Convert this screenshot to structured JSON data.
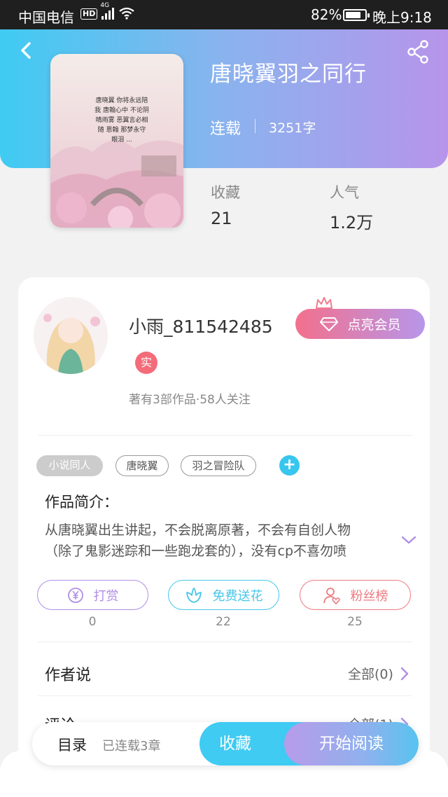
{
  "status_bar": {
    "carrier": "中国电信",
    "network_badge": "HD",
    "network_gen": "4G",
    "battery_percent": "82%",
    "battery_level": 0.82,
    "time": "晚上9:18"
  },
  "header": {
    "back_icon": "chevron-left-icon",
    "share_icon": "share-icon",
    "gradient_colors": [
      "#3fcbf2",
      "#b794ea"
    ]
  },
  "book": {
    "cover_text": "唐晓翼 你将永远陪我 唐翰心中 不论阴晴雨雾 恶翼言必相随 恩翰 那梦永守 眼泪 ...",
    "title": "唐晓翼羽之同行",
    "status": "连载",
    "word_count": "3251字",
    "stats": [
      {
        "label": "收藏",
        "value": "21"
      },
      {
        "label": "人气",
        "value": "1.2万"
      }
    ]
  },
  "author": {
    "name": "小雨_811542485",
    "verified_badge": "实",
    "meta": "著有3部作品·58人关注",
    "vip_button": "点亮会员"
  },
  "tags": {
    "items": [
      {
        "label": "小说同人",
        "style": "filled"
      },
      {
        "label": "唐晓翼",
        "style": "outline"
      },
      {
        "label": "羽之冒险队",
        "style": "outline"
      }
    ],
    "add_label": "+"
  },
  "intro": {
    "title": "作品简介：",
    "text_line1": "从唐晓翼出生讲起，不会脱离原著，不会有自创人物",
    "text_line2": "（除了鬼影迷踪和一些跑龙套的），没有cp不喜勿喷"
  },
  "actions": [
    {
      "label": "打赏",
      "icon": "yen-coin-icon",
      "count": "0",
      "color": "#b08ee6"
    },
    {
      "label": "免费送花",
      "icon": "flower-icon",
      "count": "22",
      "color": "#47c6ea"
    },
    {
      "label": "粉丝榜",
      "icon": "user-heart-icon",
      "count": "25",
      "color": "#ef7a80"
    }
  ],
  "author_says": {
    "title": "作者说",
    "link": "全部(0)"
  },
  "comments": {
    "title": "评论",
    "link": "全部(1)"
  },
  "bottom_bar": {
    "catalog": "目录",
    "chapters": "已连载3章",
    "favorite": "收藏",
    "read": "开始阅读"
  }
}
